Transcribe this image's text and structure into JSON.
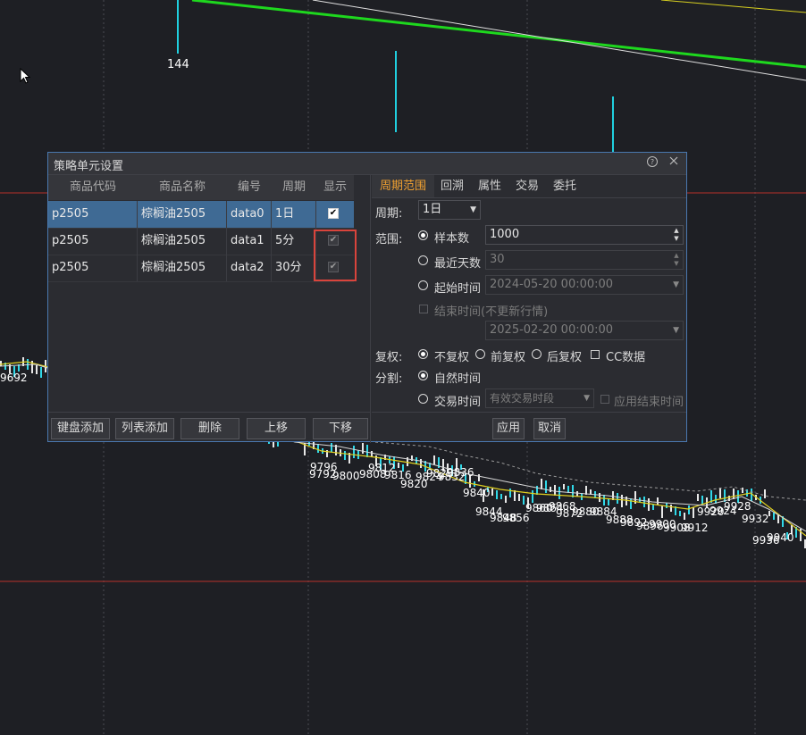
{
  "background": {
    "labels": [
      "144",
      "9692",
      "9796",
      "9792",
      "9800",
      "9808",
      "9812",
      "9816",
      "9820",
      "9824",
      "9828",
      "9832",
      "9836",
      "9840",
      "9844",
      "9848",
      "9856",
      "9860",
      "9864",
      "9868",
      "9872",
      "9880",
      "9884",
      "9888",
      "9892",
      "9896",
      "9900",
      "9908",
      "9912",
      "9920",
      "9924",
      "9928",
      "9932",
      "9936",
      "9940"
    ]
  },
  "dialog": {
    "title": "策略单元设置",
    "help_icon": "help-circle-icon",
    "close_icon": "close-icon",
    "table": {
      "headers": [
        "商品代码",
        "商品名称",
        "编号",
        "周期",
        "显示"
      ],
      "rows": [
        {
          "code": "p2505",
          "name": "棕榈油2505",
          "id": "data0",
          "period": "1日",
          "show": true,
          "selected": true,
          "enabled": true
        },
        {
          "code": "p2505",
          "name": "棕榈油2505",
          "id": "data1",
          "period": "5分",
          "show": true,
          "selected": false,
          "enabled": false
        },
        {
          "code": "p2505",
          "name": "棕榈油2505",
          "id": "data2",
          "period": "30分",
          "show": true,
          "selected": false,
          "enabled": false
        }
      ]
    },
    "left_buttons": {
      "keyboard_add": "键盘添加",
      "list_add": "列表添加",
      "delete": "删除",
      "move_up": "上移",
      "move_down": "下移"
    },
    "tabs": [
      "周期范围",
      "回溯",
      "属性",
      "交易",
      "委托"
    ],
    "active_tab": "周期范围",
    "settings": {
      "period_label": "周期:",
      "period_value": "1日",
      "range_label": "范围:",
      "sample_count_label": "样本数",
      "sample_count_value": "1000",
      "recent_days_label": "最近天数",
      "recent_days_value": "30",
      "start_time_label": "起始时间",
      "start_time_value": "2024-05-20 00:00:00",
      "end_time_label": "结束时间(不更新行情)",
      "end_time_value": "2025-02-20 00:00:00",
      "adjust_label": "复权:",
      "adjust_options": [
        "不复权",
        "前复权",
        "后复权"
      ],
      "cc_data_label": "CC数据",
      "split_label": "分割:",
      "natural_time_label": "自然时间",
      "trading_time_label": "交易时间",
      "trading_session_value": "有效交易时段",
      "apply_end_time_label": "应用结束时间"
    },
    "right_buttons": {
      "apply": "应用",
      "cancel": "取消"
    }
  },
  "colors": {
    "accent": "#f0a030",
    "selection": "#3f6a94",
    "highlight_box": "#d9443c",
    "dialog_border": "#4a78b0"
  }
}
